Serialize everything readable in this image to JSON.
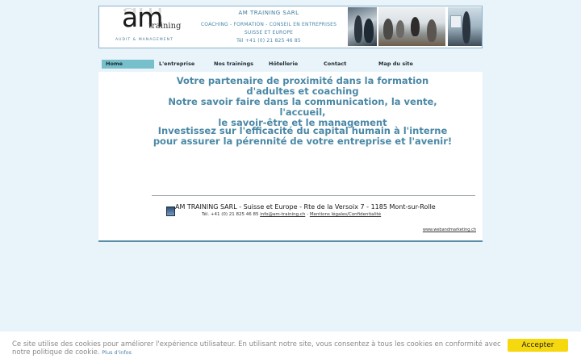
{
  "header": {
    "logo": {
      "main": "am",
      "script": "training",
      "subtitle": "AUDIT & MANAGEMENT"
    },
    "company_name": "AM TRAINING SARL",
    "services": "COACHING - FORMATION - CONSEIL EN ENTREPRISES",
    "region": "SUISSE ET EUROPE",
    "phone": "Tél +41 (0) 21 825 46 85",
    "photos": [
      "team-meeting-photo",
      "classroom-photo",
      "presenter-photo"
    ]
  },
  "nav": {
    "items": [
      {
        "label": "Home",
        "active": true
      },
      {
        "label": "L'entreprise",
        "active": false
      },
      {
        "label": "Nos trainings",
        "active": false
      },
      {
        "label": "Hôtellerie",
        "active": false
      },
      {
        "label": "Contact",
        "active": false
      },
      {
        "label": "Map du site",
        "active": false
      }
    ],
    "active_color": "#77c0cb"
  },
  "main": {
    "tagline_lines": [
      "Votre partenaire de proximité dans la formation d'adultes et coaching",
      "Notre savoir faire dans la communication, la vente, l'accueil,",
      "le savoir-être et le management"
    ],
    "mission_lines": [
      "Investissez sur l'efficacité du capital humain à l'interne",
      "pour assurer la pérennité de votre entreprise et l'avenir!"
    ],
    "text_color": "#4a88a6"
  },
  "footer": {
    "address": "AM TRAINING SARL - Suisse et Europe - Rte de la Versoix 7 - 1185 Mont-sur-Rolle",
    "phone": "Tél. +41 (0) 21 825 46 85",
    "email": "info@am-training.ch",
    "separator": "-",
    "legal_link": "Mentions légales/Confidentialité",
    "credit": "www.webandmarketing.ch"
  },
  "cookie": {
    "text": "Ce site utilise des cookies pour améliorer l'expérience utilisateur. En utilisant notre site, vous consentez à tous les cookies en conformité avec notre politique de cookie.",
    "more_link": "Plus d'infos",
    "accept_label": "Accepter",
    "accept_color": "#f5d80e"
  },
  "colors": {
    "background": "#e8f3fa",
    "accent": "#4a88a6",
    "border": "#5a8ea6"
  }
}
